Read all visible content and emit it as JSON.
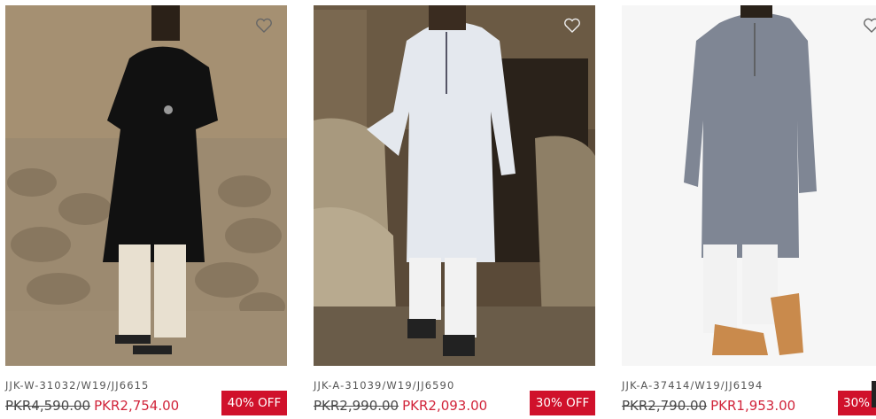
{
  "products": [
    {
      "sku": "JJK-W-31032/W19/JJ6615",
      "old_price": "PKR4,590.00",
      "new_price": "PKR2,754.00",
      "discount": "40% OFF",
      "image": "model-black-kurta",
      "wishlist_icon": "heart-outline-icon"
    },
    {
      "sku": "JJK-A-31039/W19/JJ6590",
      "old_price": "PKR2,990.00",
      "new_price": "PKR2,093.00",
      "discount": "30% OFF",
      "image": "model-light-blue-kurta",
      "wishlist_icon": "heart-outline-icon"
    },
    {
      "sku": "JJK-A-37414/W19/JJ6194",
      "old_price": "PKR2,790.00",
      "new_price": "PKR1,953.00",
      "discount": "30%",
      "image": "model-grey-kurta",
      "wishlist_icon": "heart-outline-icon"
    }
  ],
  "colors": {
    "sale": "#d0112b",
    "sale_text": "#d1243a"
  }
}
